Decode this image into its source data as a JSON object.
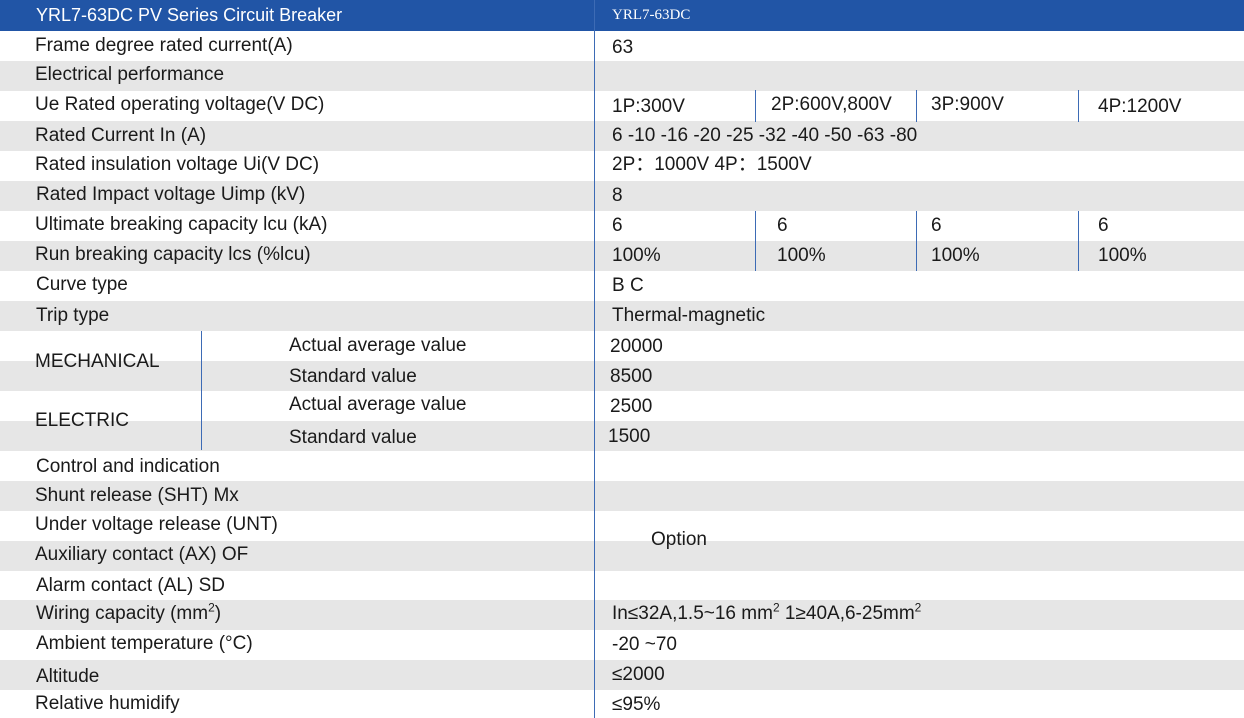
{
  "header": {
    "title": "YRL7-63DC PV Series  Circuit Breaker",
    "model": "YRL7-63DC"
  },
  "rows": {
    "frame_current": {
      "label": "Frame degree rated current(A)",
      "value": "63"
    },
    "electrical_performance": {
      "label": "Electrical performance"
    },
    "ue_voltage": {
      "label": "Ue Rated operating voltage(V DC)",
      "values": [
        "1P:300V",
        "2P:600V,800V",
        "3P:900V",
        "4P:1200V"
      ]
    },
    "rated_current": {
      "label": "Rated Current In (A)",
      "value": "6 -10 -16 -20 -25 -32 -40 -50 -63 -80"
    },
    "insulation_voltage": {
      "label": "Rated insulation voltage Ui(V DC)",
      "value": "2P：1000V  4P：1500V"
    },
    "impact_voltage": {
      "label": "Rated Impact voltage Uimp (kV)",
      "value": "8"
    },
    "icu": {
      "label": "Ultimate breaking capacity lcu (kA)",
      "values": [
        "6",
        "6",
        "6",
        "6"
      ]
    },
    "ics": {
      "label": "Run breaking capacity lcs (%lcu)",
      "values": [
        "100%",
        "100%",
        "100%",
        "100%"
      ]
    },
    "curve_type": {
      "label": "Curve type",
      "value": "B  C"
    },
    "trip_type": {
      "label": "Trip type",
      "value": "Thermal-magnetic"
    },
    "mechanical": {
      "label": "MECHANICAL",
      "actual_label": "Actual average value",
      "actual_value": "20000",
      "standard_label": "Standard value",
      "standard_value": "8500"
    },
    "electric": {
      "label": "ELECTRIC",
      "actual_label": "Actual average value",
      "actual_value": "2500",
      "standard_label": "Standard value",
      "standard_value": "1500"
    },
    "control_indication": {
      "label": "Control and indication"
    },
    "shunt_release": {
      "label": "Shunt release (SHT)   Mx"
    },
    "under_voltage": {
      "label": "Under voltage release (UNT)"
    },
    "auxiliary_contact": {
      "label": "Auxiliary contact (AX)   OF"
    },
    "alarm_contact": {
      "label": "Alarm contact (AL)   SD"
    },
    "option_value": "Option",
    "wiring": {
      "label": "Wiring capacity (mm",
      "label_sup": "2",
      "label_end": ")",
      "value_a": "In≤32A,1.5~16 mm",
      "value_a_sup": "2",
      "value_b": " 1≥40A,6-25mm",
      "value_b_sup": "2"
    },
    "ambient_temp": {
      "label": "Ambient temperature (°C)",
      "value": "-20  ~70"
    },
    "altitude": {
      "label": "Altitude",
      "value": "≤2000"
    },
    "humidity": {
      "label": "Relative humidify",
      "value": "≤95%"
    }
  }
}
